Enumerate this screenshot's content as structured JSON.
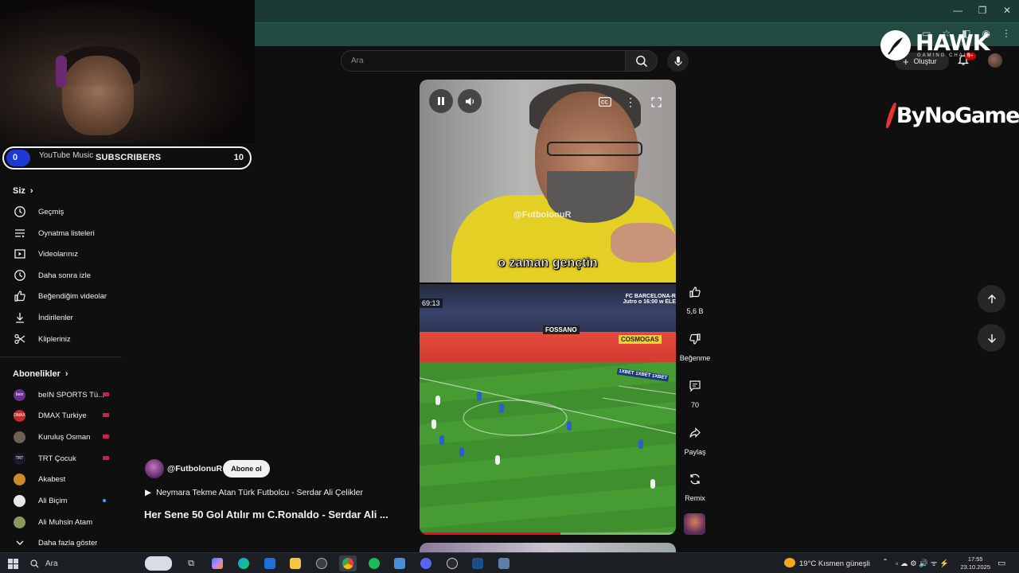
{
  "browser": {
    "window_controls": [
      "—",
      "❐",
      "✕"
    ]
  },
  "subscriber_bar": {
    "left_value": "0",
    "music_label": "YouTube Music",
    "label": "SUBSCRIBERS",
    "right_value": "10"
  },
  "sidebar": {
    "you_heading": "Siz",
    "you_items": [
      {
        "label": "Geçmiş",
        "icon": "history-icon"
      },
      {
        "label": "Oynatma listeleri",
        "icon": "playlists-icon"
      },
      {
        "label": "Videolarınız",
        "icon": "your-videos-icon"
      },
      {
        "label": "Daha sonra izle",
        "icon": "watch-later-icon"
      },
      {
        "label": "Beğendiğim videolar",
        "icon": "liked-videos-icon"
      },
      {
        "label": "İndirilenler",
        "icon": "downloads-icon"
      },
      {
        "label": "Klipleriniz",
        "icon": "clips-icon"
      }
    ],
    "subs_heading": "Abonelikler",
    "subscriptions": [
      {
        "label": "beIN SPORTS Tü...",
        "status": "live",
        "color": "#6a2f8f",
        "initials": "bein"
      },
      {
        "label": "DMAX Turkiye",
        "status": "live",
        "color": "#c42b2b",
        "initials": "DMAX"
      },
      {
        "label": "Kuruluş Osman",
        "status": "live",
        "color": "#6b6255",
        "initials": ""
      },
      {
        "label": "TRT Çocuk",
        "status": "live",
        "color": "#1a1a2e",
        "initials": "TRT"
      },
      {
        "label": "Akabest",
        "status": "",
        "color": "#c98a2c",
        "initials": ""
      },
      {
        "label": "Ali Biçim",
        "status": "new",
        "color": "#e8e8e8",
        "initials": ""
      },
      {
        "label": "Ali Muhsin Atam",
        "status": "",
        "color": "#8a9a5a",
        "initials": ""
      }
    ],
    "show_more": "Daha fazla göster"
  },
  "search": {
    "placeholder": "Ara"
  },
  "topbar": {
    "create_label": "Oluştur",
    "notification_badge": "9+"
  },
  "overlays": {
    "hawk_title": "HAWK",
    "hawk_subtitle": "GAMING CHAIR",
    "bynogame": "ByNoGame"
  },
  "short": {
    "watermark": "@FutbolonuR",
    "caption": "o zaman gençtin",
    "timer": "69:13",
    "scorebug_line1": "FC BARCELONA-R",
    "scorebug_line2": "Jutro o 16:00 w ELE",
    "board_fossano": "FOSSANO",
    "board_cosmo": "COSMOGAS",
    "board_1xbet": "1XBET  1XBET  1XBET",
    "progress_fraction": 0.55
  },
  "actions": {
    "like_count": "5,6 B",
    "dislike_label": "Beğenme",
    "comment_count": "70",
    "share_label": "Paylaş",
    "remix_label": "Remix"
  },
  "channel": {
    "handle": "@FutbolonuR",
    "subscribe_label": "Abone ol",
    "related_title": "Neymara Tekme Atan Türk Futbolcu - Serdar Ali Çelikler",
    "title": "Her Sene 50 Gol Atılır mı C.Ronaldo - Serdar Ali ..."
  },
  "taskbar": {
    "search_placeholder": "Ara",
    "weather": "19°C  Kısmen güneşli",
    "time": "17:55",
    "date": "23.10.2025"
  },
  "colors": {
    "accent_red": "#ff0033",
    "subscribers_pill": "#1d3ad6",
    "browser_green": "#234a41"
  }
}
